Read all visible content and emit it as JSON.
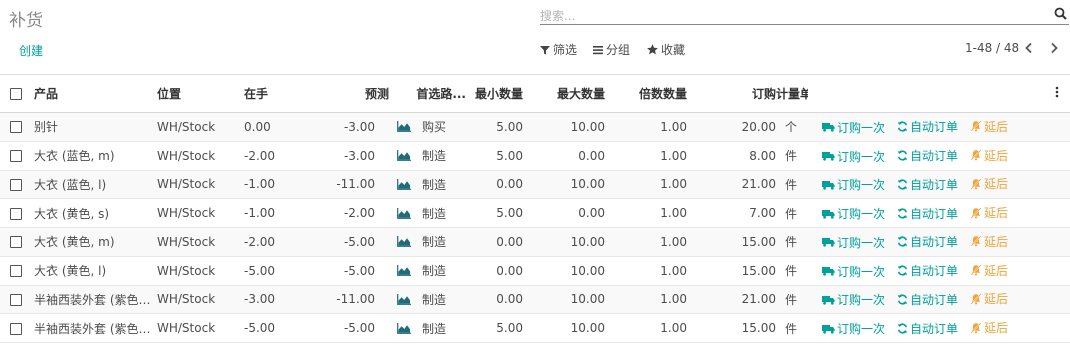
{
  "page": {
    "title": "补货",
    "search_placeholder": "搜索...",
    "create_label": "创建",
    "filter_label": "筛选",
    "group_label": "分组",
    "favorites_label": "收藏",
    "pager": "1-48 / 48"
  },
  "table": {
    "headers": {
      "product": "产品",
      "location": "位置",
      "on_hand": "在手",
      "forecast": "预测",
      "route": "首选路...",
      "min_qty": "最小数量",
      "max_qty": "最大数量",
      "multiple": "倍数数量",
      "order": "订购",
      "uom": "计量单位"
    },
    "actions": {
      "order_once": "订购一次",
      "automate": "自动订单",
      "snooze": "延后"
    },
    "rows": [
      {
        "product": "别针",
        "location": "WH/Stock",
        "on_hand": "0.00",
        "forecast": "-3.00",
        "route": "购买",
        "min": "5.00",
        "max": "10.00",
        "multiple": "1.00",
        "order": "20.00",
        "uom": "个"
      },
      {
        "product": "大衣 (蓝色, m)",
        "location": "WH/Stock",
        "on_hand": "-2.00",
        "forecast": "-3.00",
        "route": "制造",
        "min": "5.00",
        "max": "0.00",
        "multiple": "1.00",
        "order": "8.00",
        "uom": "件"
      },
      {
        "product": "大衣 (蓝色, l)",
        "location": "WH/Stock",
        "on_hand": "-1.00",
        "forecast": "-11.00",
        "route": "制造",
        "min": "0.00",
        "max": "10.00",
        "multiple": "1.00",
        "order": "21.00",
        "uom": "件"
      },
      {
        "product": "大衣 (黄色, s)",
        "location": "WH/Stock",
        "on_hand": "-1.00",
        "forecast": "-2.00",
        "route": "制造",
        "min": "5.00",
        "max": "0.00",
        "multiple": "1.00",
        "order": "7.00",
        "uom": "件"
      },
      {
        "product": "大衣 (黄色, m)",
        "location": "WH/Stock",
        "on_hand": "-2.00",
        "forecast": "-5.00",
        "route": "制造",
        "min": "0.00",
        "max": "10.00",
        "multiple": "1.00",
        "order": "15.00",
        "uom": "件"
      },
      {
        "product": "大衣 (黄色, l)",
        "location": "WH/Stock",
        "on_hand": "-5.00",
        "forecast": "-5.00",
        "route": "制造",
        "min": "0.00",
        "max": "10.00",
        "multiple": "1.00",
        "order": "15.00",
        "uom": "件"
      },
      {
        "product": "半袖西装外套 (紫色, s)",
        "location": "WH/Stock",
        "on_hand": "-3.00",
        "forecast": "-11.00",
        "route": "制造",
        "min": "0.00",
        "max": "10.00",
        "multiple": "1.00",
        "order": "21.00",
        "uom": "件"
      },
      {
        "product": "半袖西装外套 (紫色, ...",
        "location": "WH/Stock",
        "on_hand": "-5.00",
        "forecast": "-5.00",
        "route": "制造",
        "min": "5.00",
        "max": "10.00",
        "multiple": "1.00",
        "order": "15.00",
        "uom": "件"
      }
    ]
  },
  "icons": {
    "search": "search-icon",
    "filter": "filter-icon",
    "group": "group-icon",
    "favorite": "star-icon",
    "prev": "chevron-left-icon",
    "next": "chevron-right-icon",
    "forecast": "area-chart-icon",
    "truck": "truck-icon",
    "refresh": "refresh-icon",
    "snooze": "bell-slash-icon",
    "options": "vertical-dots-icon"
  },
  "colors": {
    "accent": "#00a09d",
    "snooze": "#f0a43b",
    "chart_icon": "#1f6b7a"
  }
}
